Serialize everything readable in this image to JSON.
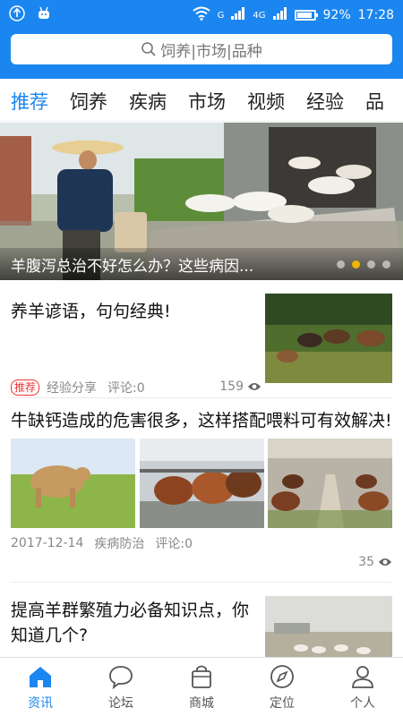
{
  "status_bar": {
    "network_label": "G",
    "network_4g": "4G",
    "battery": "92%",
    "battery_level": 0.92,
    "time": "17:28"
  },
  "search": {
    "placeholder": "饲养|市场|品种"
  },
  "tabs": [
    {
      "label": "推荐",
      "active": true
    },
    {
      "label": "饲养"
    },
    {
      "label": "疾病"
    },
    {
      "label": "市场"
    },
    {
      "label": "视频"
    },
    {
      "label": "经验"
    },
    {
      "label": "品"
    }
  ],
  "banner": {
    "caption": "羊腹泻总治不好怎么办？这些病因...",
    "dot_count": 4,
    "active_dot": 1
  },
  "articles": [
    {
      "title": "养羊谚语，句句经典!",
      "badge": "推荐",
      "category": "经验分享",
      "comments": "评论:0",
      "views": "159"
    },
    {
      "title": "牛缺钙造成的危害很多，这样搭配喂料可有效解决!",
      "date": "2017-12-14",
      "category": "疾病防治",
      "comments": "评论:0",
      "views": "35"
    },
    {
      "title": "提高羊群繁殖力必备知识点，你知道几个?"
    }
  ],
  "bottom_nav": [
    {
      "label": "资讯",
      "icon": "home-icon",
      "active": true
    },
    {
      "label": "论坛",
      "icon": "chat-bubble-icon"
    },
    {
      "label": "商城",
      "icon": "shopping-bag-icon"
    },
    {
      "label": "定位",
      "icon": "compass-icon"
    },
    {
      "label": "个人",
      "icon": "person-icon"
    }
  ],
  "colors": {
    "accent": "#1b86f0",
    "badge": "#e33333",
    "active_dot": "#f0b500"
  }
}
